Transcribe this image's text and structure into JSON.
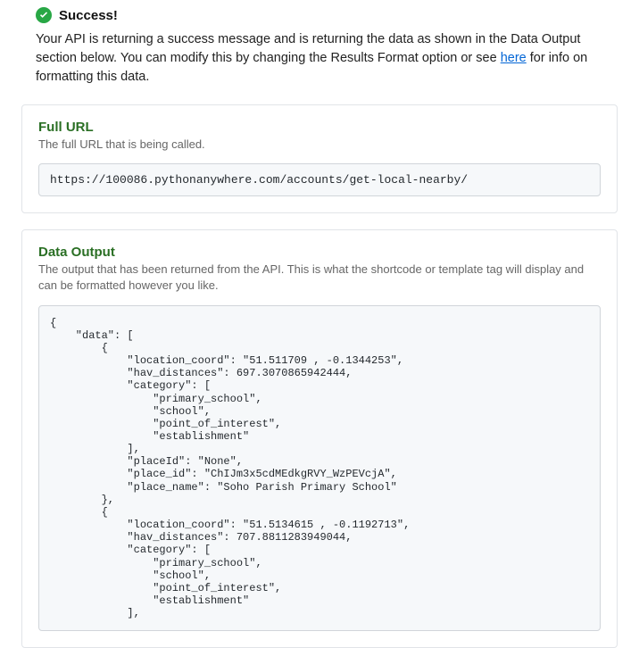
{
  "success": {
    "title": "Success!",
    "body_prefix": "Your API is returning a success message and is returning the data as shown in the Data Output section below. You can modify this by changing the Results Format option or see ",
    "link_text": "here",
    "body_suffix": " for info on formatting this data."
  },
  "full_url": {
    "title": "Full URL",
    "desc": "The full URL that is being called.",
    "value": "https://100086.pythonanywhere.com/accounts/get-local-nearby/"
  },
  "data_output": {
    "title": "Data Output",
    "desc": "The output that has been returned from the API. This is what the shortcode or template tag will display and can be formatted however you like.",
    "code": "{\n    \"data\": [\n        {\n            \"location_coord\": \"51.511709 , -0.1344253\",\n            \"hav_distances\": 697.3070865942444,\n            \"category\": [\n                \"primary_school\",\n                \"school\",\n                \"point_of_interest\",\n                \"establishment\"\n            ],\n            \"placeId\": \"None\",\n            \"place_id\": \"ChIJm3x5cdMEdkgRVY_WzPEVcjA\",\n            \"place_name\": \"Soho Parish Primary School\"\n        },\n        {\n            \"location_coord\": \"51.5134615 , -0.1192713\",\n            \"hav_distances\": 707.8811283949044,\n            \"category\": [\n                \"primary_school\",\n                \"school\",\n                \"point_of_interest\",\n                \"establishment\"\n            ],"
  }
}
